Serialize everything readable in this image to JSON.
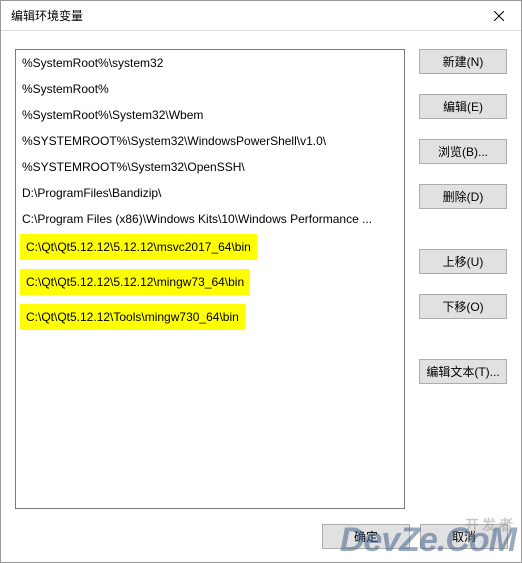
{
  "titlebar": {
    "title": "编辑环境变量"
  },
  "list": {
    "items": [
      {
        "text": "%SystemRoot%\\system32",
        "hl": false
      },
      {
        "text": "%SystemRoot%",
        "hl": false
      },
      {
        "text": "%SystemRoot%\\System32\\Wbem",
        "hl": false
      },
      {
        "text": "%SYSTEMROOT%\\System32\\WindowsPowerShell\\v1.0\\",
        "hl": false
      },
      {
        "text": "%SYSTEMROOT%\\System32\\OpenSSH\\",
        "hl": false
      },
      {
        "text": "D:\\ProgramFiles\\Bandizip\\",
        "hl": false
      },
      {
        "text": "C:\\Program Files (x86)\\Windows Kits\\10\\Windows Performance ...",
        "hl": false
      },
      {
        "text": "C:\\Qt\\Qt5.12.12\\5.12.12\\msvc2017_64\\bin",
        "hl": true
      },
      {
        "text": "C:\\Qt\\Qt5.12.12\\5.12.12\\mingw73_64\\bin",
        "hl": true
      },
      {
        "text": "C:\\Qt\\Qt5.12.12\\Tools\\mingw730_64\\bin",
        "hl": true
      }
    ]
  },
  "buttons": {
    "new": "新建(N)",
    "edit": "编辑(E)",
    "browse": "浏览(B)...",
    "delete": "删除(D)",
    "moveup": "上移(U)",
    "movedown": "下移(O)",
    "edittext": "编辑文本(T)...",
    "ok": "确定",
    "cancel": "取消"
  },
  "watermark": {
    "small": "开发者",
    "main": "DevZe.CoM"
  }
}
